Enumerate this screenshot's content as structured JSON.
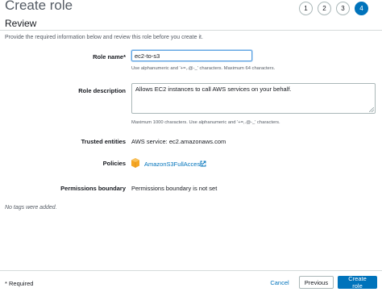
{
  "page": {
    "title": "Create role"
  },
  "steps": [
    "1",
    "2",
    "3",
    "4"
  ],
  "review": {
    "title": "Review",
    "description": "Provide the required information below and review this role before you create it."
  },
  "fields": {
    "role_name": {
      "label": "Role name",
      "required_marker": "*",
      "value": "ec2-to-s3",
      "hint": "Use alphanumeric and '+=,.@-_' characters. Maximum 64 characters."
    },
    "role_description": {
      "label": "Role description",
      "value": "Allows EC2 instances to call AWS services on your behalf.",
      "hint": "Maximum 1000 characters. Use alphanumeric and '+=,.@-_' characters."
    },
    "trusted_entities": {
      "label": "Trusted entities",
      "value": "AWS service: ec2.amazonaws.com"
    },
    "policies": {
      "label": "Policies",
      "items": [
        "AmazonS3FullAccess"
      ]
    },
    "permissions_boundary": {
      "label": "Permissions boundary",
      "value": "Permissions boundary is not set"
    }
  },
  "tags": {
    "empty_text": "No tags were added."
  },
  "footer": {
    "required_note": "* Required",
    "cancel_label": "Cancel",
    "previous_label": "Previous",
    "create_label": "Create role"
  },
  "colors": {
    "accent": "#0073bb",
    "policy_icon": "#f5a623",
    "border": "#aab7b8"
  },
  "icons": {
    "policy": "policy-box-icon",
    "external_link": "external-link-icon"
  }
}
